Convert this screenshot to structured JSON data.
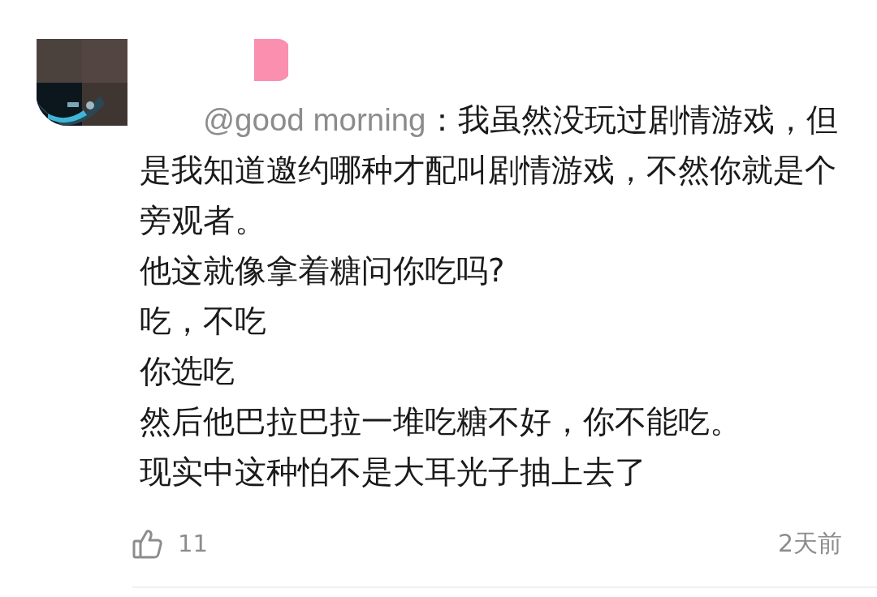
{
  "comment": {
    "reply_to": "@good morning",
    "paragraphs": [
      "：我虽然没玩过剧情游戏，但是我知道邀约哪种才配叫剧情游戏，不然你就是个旁观者。",
      "他这就像拿着糖问你吃吗?",
      "吃，不吃",
      "你选吃",
      "然后他巴拉巴拉一堆吃糖不好，你不能吃。",
      "现实中这种怕不是大耳光子抽上去了"
    ],
    "likes": "11",
    "time": "2天前"
  }
}
